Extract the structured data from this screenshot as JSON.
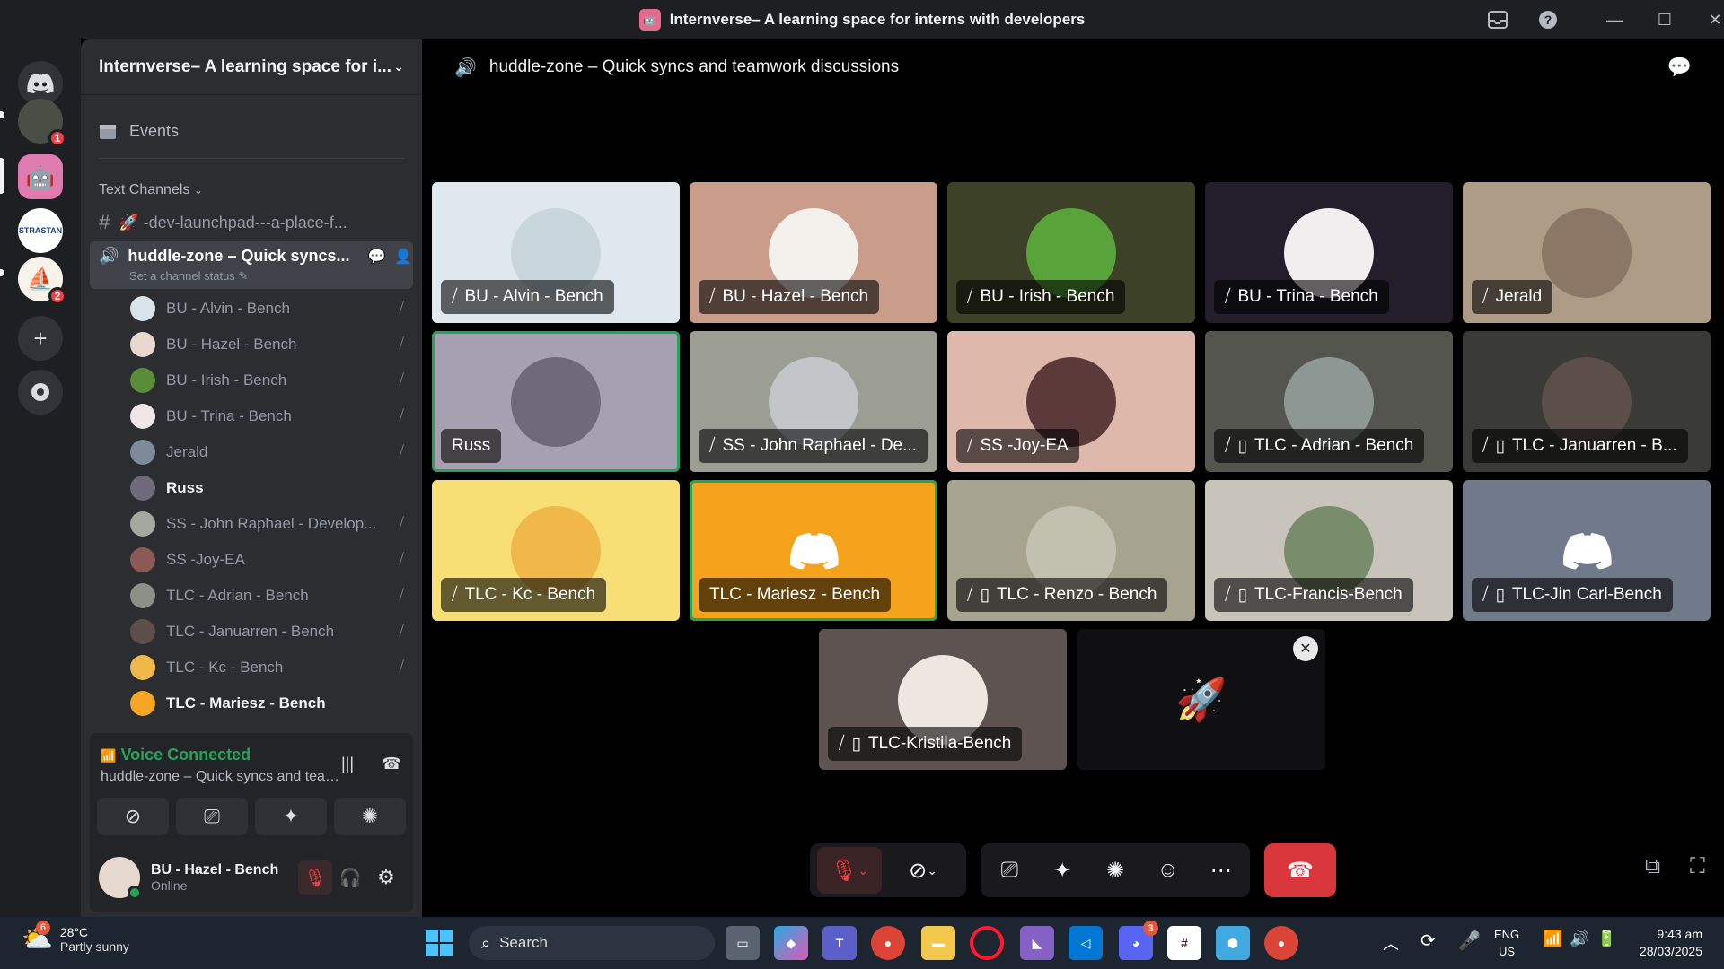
{
  "titlebar": {
    "title": "Internverse– A learning space for interns with developers"
  },
  "rail": {
    "badges": [
      "1",
      "2"
    ],
    "strastan_label": "STRASTAN"
  },
  "sidebar": {
    "server_name": "Internverse– A learning space for i...",
    "events_label": "Events",
    "category_label": "Text Channels",
    "text_channel": "🚀 -dev-launchpad---a-place-f...",
    "active_channel": "huddle-zone – Quick syncs...",
    "channel_status": "Set a channel status",
    "members": [
      {
        "name": "BU - Alvin - Bench",
        "color": "#d9e4ea"
      },
      {
        "name": "BU - Hazel - Bench",
        "color": "#e8d9cf"
      },
      {
        "name": "BU - Irish - Bench",
        "color": "#5b8c3a"
      },
      {
        "name": "BU - Trina - Bench",
        "color": "#f0e6e8"
      },
      {
        "name": "Jerald",
        "color": "#7d8a99"
      },
      {
        "name": "Russ",
        "color": "#6f6a7a"
      },
      {
        "name": "SS - John Raphael - Develop...",
        "color": "#a4a8a0"
      },
      {
        "name": "SS -Joy-EA",
        "color": "#8c5a56"
      },
      {
        "name": "TLC - Adrian - Bench",
        "color": "#8a8f87"
      },
      {
        "name": "TLC - Januarren - Bench",
        "color": "#5c4f4a"
      },
      {
        "name": "TLC - Kc - Bench",
        "color": "#f0b84a"
      },
      {
        "name": "TLC - Mariesz - Bench",
        "color": "#f5a623"
      }
    ]
  },
  "voice": {
    "status": "Voice Connected",
    "channel": "huddle-zone – Quick syncs and teamwork ...",
    "user_name": "BU - Hazel - Bench",
    "user_status": "Online"
  },
  "main": {
    "header": "huddle-zone – Quick syncs and teamwork discussions",
    "tiles": [
      {
        "label": "BU - Alvin - Bench",
        "bg": "#dfe8ee",
        "pic": "#c9d6de",
        "mic_off": true,
        "mobile": false
      },
      {
        "label": "BU - Hazel - Bench",
        "bg": "#c99d8a",
        "pic": "#f4f0ec",
        "mic_off": true,
        "mobile": false
      },
      {
        "label": "BU - Irish - Bench",
        "bg": "#3d4128",
        "pic": "#58a33a",
        "mic_off": true,
        "mobile": false
      },
      {
        "label": "BU - Trina - Bench",
        "bg": "#221e2c",
        "pic": "#f2eef0",
        "mic_off": true,
        "mobile": false
      },
      {
        "label": "Jerald",
        "bg": "#ae9c86",
        "pic": "#8c7666",
        "mic_off": true,
        "mobile": false
      },
      {
        "label": "Russ",
        "bg": "#a7a0b0",
        "pic": "#6f6a7a",
        "mic_off": false,
        "mobile": false
      },
      {
        "label": "SS - John Raphael - De...",
        "bg": "#9c9e94",
        "pic": "#c2c6c8",
        "mic_off": true,
        "mobile": false
      },
      {
        "label": "SS -Joy-EA",
        "bg": "#dfb8ac",
        "pic": "#5d3a3a",
        "mic_off": true,
        "mobile": false
      },
      {
        "label": "TLC - Adrian - Bench",
        "bg": "#555550",
        "pic": "#8d9794",
        "mic_off": true,
        "mobile": true
      },
      {
        "label": "TLC - Januarren - B...",
        "bg": "#3a3a36",
        "pic": "#5c4f4a",
        "mic_off": true,
        "mobile": true
      },
      {
        "label": "TLC - Kc - Bench",
        "bg": "#f7df76",
        "pic": "#f0b84a",
        "mic_off": true,
        "mobile": false
      },
      {
        "label": "TLC - Mariesz - Bench",
        "bg": "#f5a21c",
        "pic": "#f5a21c",
        "mic_off": false,
        "mobile": false
      },
      {
        "label": "TLC - Renzo - Bench",
        "bg": "#a6a48e",
        "pic": "#c2c0ae",
        "mic_off": true,
        "mobile": true
      },
      {
        "label": "TLC-Francis-Bench",
        "bg": "#c8c3bb",
        "pic": "#7a8d6a",
        "mic_off": true,
        "mobile": true
      },
      {
        "label": "TLC-Jin Carl-Bench",
        "bg": "#707a8a",
        "pic": "#707a8a",
        "mic_off": true,
        "mobile": true
      },
      {
        "label": "TLC-Kristila-Bench",
        "bg": "#5e5350",
        "pic": "#efe6e0",
        "mic_off": true,
        "mobile": true
      }
    ]
  },
  "taskbar": {
    "weather_temp": "28°C",
    "weather_desc": "Partly sunny",
    "weather_badge": "6",
    "search_placeholder": "Search",
    "discord_badge": "3",
    "lang_top": "ENG",
    "lang_bottom": "US",
    "time": "9:43 am",
    "date": "28/03/2025"
  },
  "colors": {
    "accent_green": "#23a55a",
    "danger_red": "#da373c",
    "discord_blurple": "#5865f2"
  }
}
